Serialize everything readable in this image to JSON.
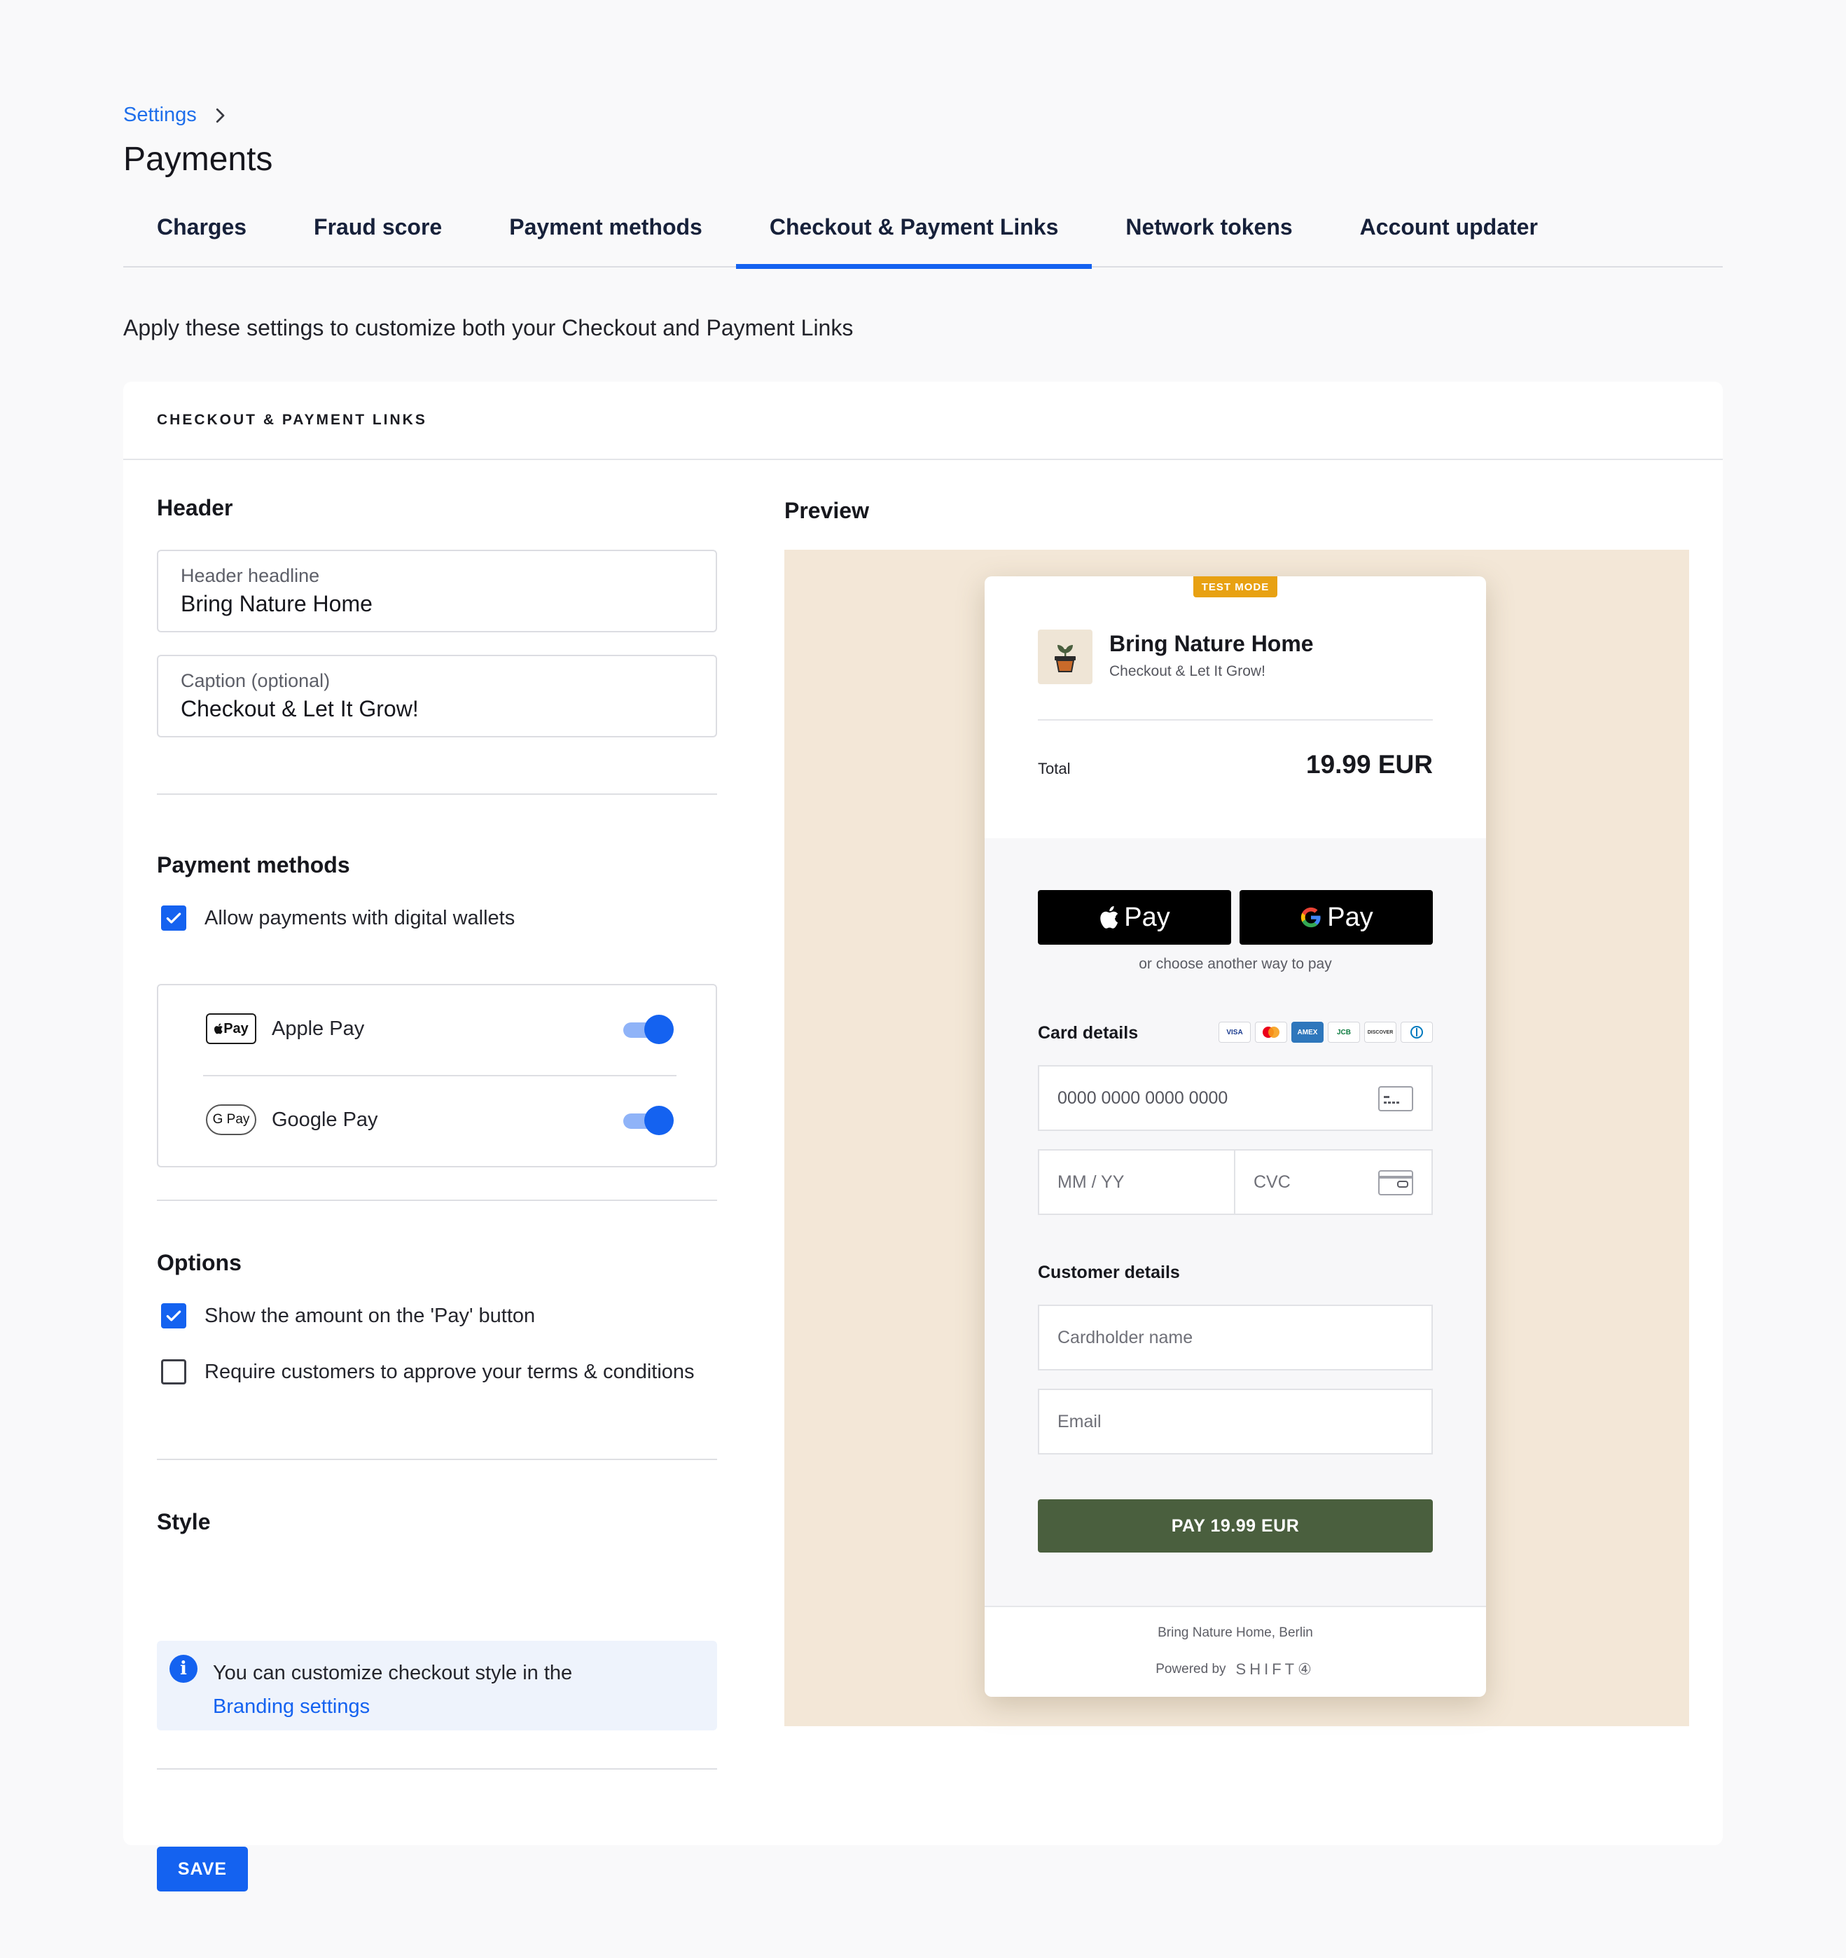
{
  "breadcrumb": {
    "parent": "Settings"
  },
  "page": {
    "title": "Payments",
    "intro": "Apply these settings to customize both your Checkout and Payment Links"
  },
  "tabs": [
    {
      "label": "Charges",
      "active": false
    },
    {
      "label": "Fraud score",
      "active": false
    },
    {
      "label": "Payment methods",
      "active": false
    },
    {
      "label": "Checkout & Payment Links",
      "active": true
    },
    {
      "label": "Network tokens",
      "active": false
    },
    {
      "label": "Account updater",
      "active": false
    }
  ],
  "card": {
    "heading": "CHECKOUT & PAYMENT LINKS",
    "header_section": {
      "title": "Header",
      "headline_label": "Header headline",
      "headline_value": "Bring Nature Home",
      "caption_label": "Caption (optional)",
      "caption_value": "Checkout & Let It Grow!"
    },
    "payment_methods": {
      "title": "Payment methods",
      "allow_wallets_label": "Allow payments with digital wallets",
      "allow_wallets_checked": true,
      "wallets": [
        {
          "name": "Apple Pay",
          "logo": "Pay",
          "enabled": true
        },
        {
          "name": "Google Pay",
          "logo": "G Pay",
          "enabled": true
        }
      ]
    },
    "options": {
      "title": "Options",
      "items": [
        {
          "label": "Show the amount on the 'Pay' button",
          "checked": true
        },
        {
          "label": "Require customers to approve your terms & conditions",
          "checked": false
        }
      ]
    },
    "style": {
      "title": "Style",
      "info_text": "You can customize checkout style in the",
      "info_link": "Branding settings"
    },
    "save_label": "SAVE"
  },
  "preview": {
    "title": "Preview",
    "test_badge": "TEST MODE",
    "merchant_name": "Bring Nature Home",
    "merchant_caption": "Checkout & Let It Grow!",
    "total_label": "Total",
    "total_amount": "19.99 EUR",
    "apple_pay_label": "Pay",
    "google_pay_label": "Pay",
    "or_text": "or choose another way to pay",
    "card_details_label": "Card details",
    "card_brands": [
      "VISA",
      "MC",
      "AMEX",
      "JCB",
      "DISCOVER",
      "DINERS"
    ],
    "card_number_placeholder": "0000 0000 0000 0000",
    "expiry_placeholder": "MM / YY",
    "cvc_placeholder": "CVC",
    "customer_details_label": "Customer details",
    "cardholder_placeholder": "Cardholder name",
    "email_placeholder": "Email",
    "pay_button": "PAY 19.99 EUR",
    "footer_address": "Bring Nature Home, Berlin",
    "powered_by": "Powered by",
    "powered_brand": "SHIFT④"
  },
  "colors": {
    "accent": "#1462f0",
    "pay_button": "#4a5f3e",
    "preview_bg": "#f3e7d7",
    "test_badge": "#e8a112"
  }
}
